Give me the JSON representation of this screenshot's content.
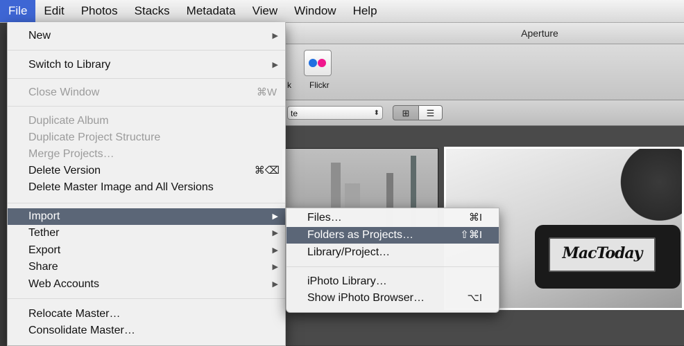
{
  "menubar": {
    "items": [
      "File",
      "Edit",
      "Photos",
      "Stacks",
      "Metadata",
      "View",
      "Window",
      "Help"
    ]
  },
  "window": {
    "title": "Aperture"
  },
  "toolbar": {
    "flickr_label": "Flickr",
    "partial_label": "k"
  },
  "browser": {
    "sort_select_text": "te",
    "sort_arrows": "⬍",
    "grid_glyph": "⊞",
    "list_glyph": "☰"
  },
  "photo": {
    "logo_text": "MacToday"
  },
  "file_menu": {
    "new": "New",
    "switch_to_library": "Switch to Library",
    "close_window": "Close Window",
    "close_window_shortcut": "⌘W",
    "duplicate_album": "Duplicate Album",
    "duplicate_project_structure": "Duplicate Project Structure",
    "merge_projects": "Merge Projects…",
    "delete_version": "Delete Version",
    "delete_version_shortcut": "⌘⌫",
    "delete_master": "Delete Master Image and All Versions",
    "import": "Import",
    "tether": "Tether",
    "export": "Export",
    "share": "Share",
    "web_accounts": "Web Accounts",
    "relocate_master": "Relocate Master…",
    "consolidate_master": "Consolidate Master…",
    "submenu_arrow": "▶"
  },
  "import_submenu": {
    "files": "Files…",
    "files_shortcut": "⌘I",
    "folders_as_projects": "Folders as Projects…",
    "folders_shortcut": "⇧⌘I",
    "library_project": "Library/Project…",
    "iphoto_library": "iPhoto Library…",
    "show_iphoto_browser": "Show iPhoto Browser…",
    "show_iphoto_shortcut": "⌥I"
  },
  "colors": {
    "menubar_active": "#3e66d4",
    "menu_highlight": "#5b6677",
    "flickr_blue": "#1f6fe0",
    "flickr_pink": "#f0168d"
  }
}
